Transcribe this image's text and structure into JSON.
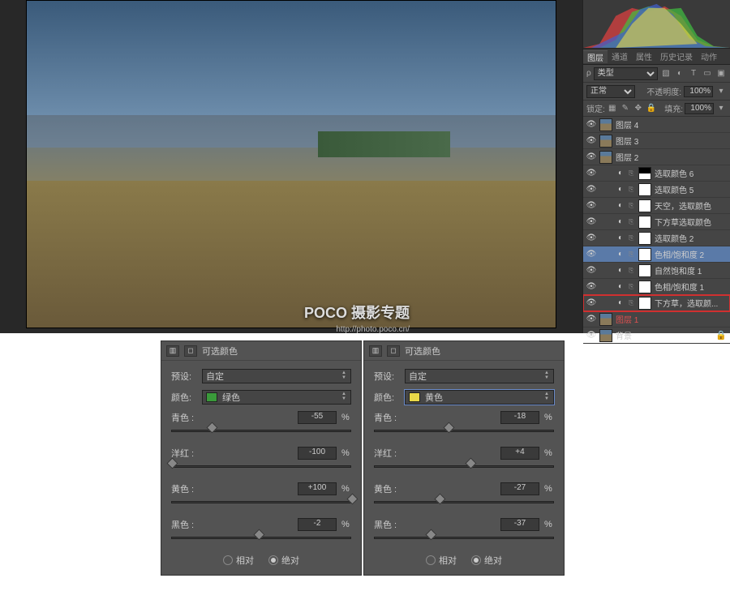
{
  "canvas": {
    "watermark_main": "POCO 摄影专题",
    "watermark_url": "http://photo.poco.cn/"
  },
  "tabs": {
    "layers": "图层",
    "channels": "通道",
    "properties": "属性",
    "history": "历史记录",
    "actions": "动作"
  },
  "filter_label": "类型",
  "blend": {
    "mode": "正常",
    "opacity_label": "不透明度:",
    "opacity": "100%",
    "fill_label": "填充:",
    "fill": "100%",
    "lock_label": "锁定:"
  },
  "layers": [
    {
      "name": "图层 4",
      "type": "img"
    },
    {
      "name": "图层 3",
      "type": "img"
    },
    {
      "name": "图层 2",
      "type": "img"
    },
    {
      "name": "选取颜色 6",
      "type": "adj",
      "mask": true
    },
    {
      "name": "选取颜色 5",
      "type": "adj"
    },
    {
      "name": "天空，选取颜色",
      "type": "adj"
    },
    {
      "name": "下方草选取颜色",
      "type": "adj"
    },
    {
      "name": "选取颜色 2",
      "type": "adj"
    },
    {
      "name": "色相/饱和度 2",
      "type": "adj",
      "sel": true
    },
    {
      "name": "自然饱和度 1",
      "type": "adj"
    },
    {
      "name": "色相/饱和度 1",
      "type": "adj"
    },
    {
      "name": "下方草，选取颜...",
      "type": "adj",
      "red": true
    },
    {
      "name": "图层 1",
      "type": "img",
      "nameRed": true
    },
    {
      "name": "背景",
      "type": "img",
      "locked": true
    }
  ],
  "sc": {
    "title": "可选颜色",
    "preset_label": "预设:",
    "preset_value": "自定",
    "color_label": "颜色:",
    "sliders": [
      "青色 :",
      "洋红 :",
      "黄色 :",
      "黑色 :"
    ],
    "pct": "%",
    "radio_rel": "相对",
    "radio_abs": "绝对"
  },
  "panelA": {
    "color": "绿色",
    "vals": [
      "-55",
      "-100",
      "+100",
      "-2"
    ],
    "pos": [
      22,
      0,
      100,
      48
    ]
  },
  "panelB": {
    "color": "黄色",
    "vals": [
      "-18",
      "+4",
      "-27",
      "-37"
    ],
    "pos": [
      41,
      53,
      36,
      31
    ]
  }
}
